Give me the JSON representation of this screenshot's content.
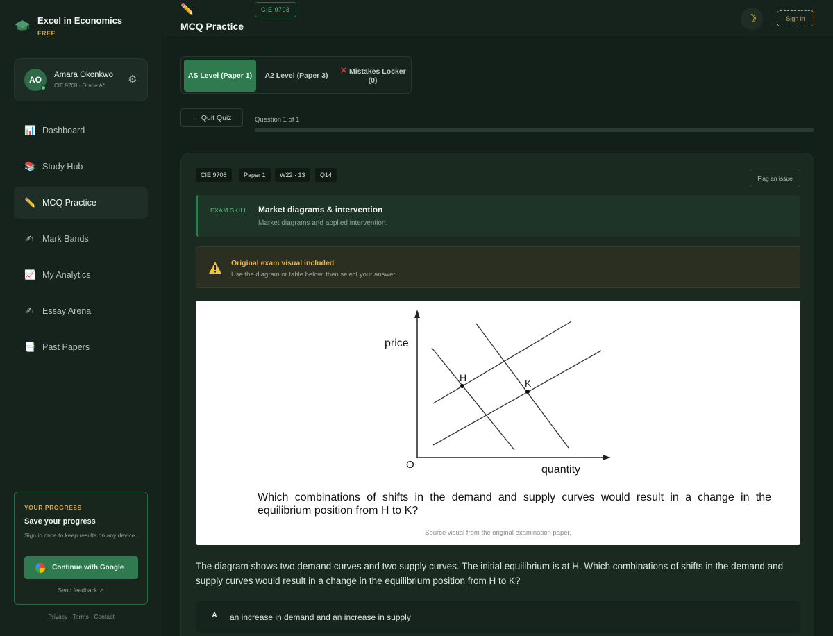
{
  "brand": {
    "title": "Excel in Economics",
    "badge": "FREE"
  },
  "profile": {
    "initials": "AO",
    "name": "Amara Okonkwo",
    "subtitle": "CIE 9708 · Grade A*"
  },
  "nav": [
    {
      "label": "Dashboard",
      "icon": "bar-chart-icon",
      "glyph": "📊"
    },
    {
      "label": "Study Hub",
      "icon": "books-icon",
      "glyph": "📚"
    },
    {
      "label": "MCQ Practice",
      "icon": "pencil-icon",
      "glyph": "✏️",
      "active": true
    },
    {
      "label": "Mark Bands",
      "icon": "writing-hand-icon",
      "glyph": "✍"
    },
    {
      "label": "My Analytics",
      "icon": "trend-chart-icon",
      "glyph": "📈"
    },
    {
      "label": "Essay Arena",
      "icon": "writing-hand-icon",
      "glyph": "✍"
    },
    {
      "label": "Past Papers",
      "icon": "document-icon",
      "glyph": "📑"
    }
  ],
  "progress_card": {
    "label": "YOUR PROGRESS",
    "title": "Save your progress",
    "description": "Sign in once to keep results on any device.",
    "google_button": "Continue with Google",
    "feedback": "Send feedback ↗"
  },
  "footer": "Privacy · Terms · Contact",
  "topbar": {
    "title": "MCQ Practice",
    "code": "CIE 9708",
    "signin": "Sign in",
    "accent": "#d9a64a"
  },
  "tabs": [
    {
      "label": "AS Level (Paper 1)",
      "active": true
    },
    {
      "label": "A2 Level (Paper 3)"
    },
    {
      "label": "Mistakes Locker (0)",
      "icon": "x-icon"
    }
  ],
  "quiz": {
    "quit": "← Quit Quiz",
    "counter": "Question 1 of 1",
    "progress": 0
  },
  "question": {
    "meta": [
      "CIE 9708",
      "Paper 1",
      "W22 · 13",
      "Q14"
    ],
    "flag": "Flag an issue",
    "skill_tag": "EXAM SKILL",
    "skill_title": "Market diagrams & intervention",
    "skill_sub": "Market diagrams and applied intervention.",
    "warn_title": "Original exam visual included",
    "warn_sub": "Use the diagram or table below, then select your answer.",
    "figure": {
      "y_label": "price",
      "x_label": "quantity",
      "origin": "O",
      "point_h": "H",
      "point_k": "K",
      "question": "Which combinations of shifts in the demand and supply curves would result in a change in the equilibrium position from H to K?",
      "source": "Source visual from the original examination paper."
    },
    "text": "The diagram shows two demand curves and two supply curves. The initial equilibrium is at H. Which combinations of shifts in the demand and supply curves would result in a change in the equilibrium position from H to K?",
    "options": [
      {
        "letter": "A",
        "text": "an increase in demand and an increase in supply"
      }
    ]
  }
}
